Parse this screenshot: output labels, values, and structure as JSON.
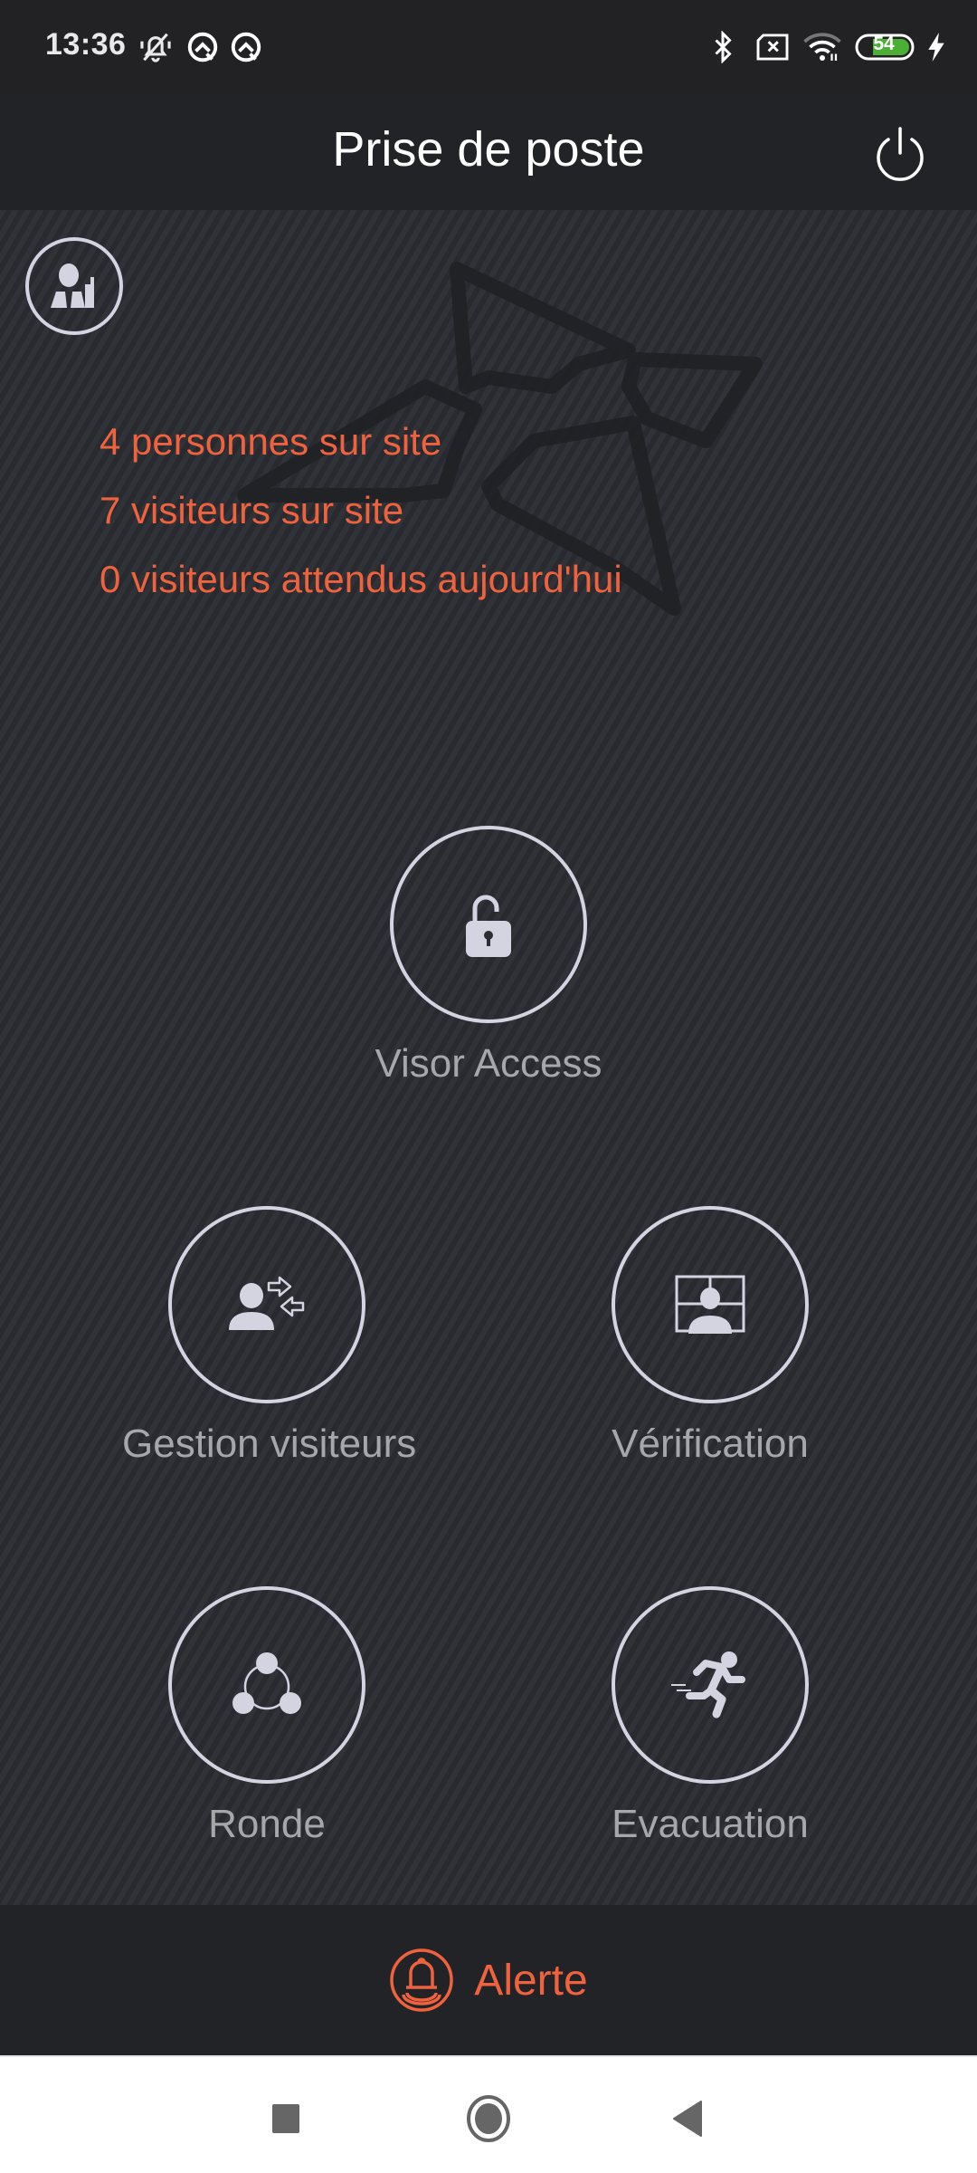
{
  "status_bar": {
    "time": "13:36",
    "battery_level": "54",
    "icons": [
      "bell-off-icon",
      "data-saver-icon",
      "data-saver-icon",
      "bluetooth-icon",
      "no-sim-icon",
      "wifi-icon",
      "battery-icon",
      "charging-icon"
    ]
  },
  "app_bar": {
    "title": "Prise de poste",
    "power_icon": "power-icon"
  },
  "main": {
    "profile_icon": "guard-profile-icon",
    "stats": [
      "4 personnes sur site",
      "7 visiteurs sur site",
      "0 visiteurs attendus aujourd'hui"
    ],
    "tiles": [
      {
        "label": "Visor Access",
        "icon": "unlock-icon"
      },
      {
        "label": "Gestion visiteurs",
        "icon": "visitor-exchange-icon"
      },
      {
        "label": "Vérification",
        "icon": "identity-check-icon"
      },
      {
        "label": "Ronde",
        "icon": "patrol-round-icon"
      },
      {
        "label": "Evacuation",
        "icon": "running-person-icon"
      }
    ]
  },
  "alert": {
    "label": "Alerte",
    "icon": "alarm-bell-icon"
  },
  "colors": {
    "accent": "#f0623e",
    "icon": "#d3d4e0",
    "label": "#a6a7aa",
    "background": "#2a2d32",
    "bar": "#222326"
  },
  "nav_bar": {
    "buttons": [
      "recents-button",
      "home-button",
      "back-button"
    ]
  }
}
